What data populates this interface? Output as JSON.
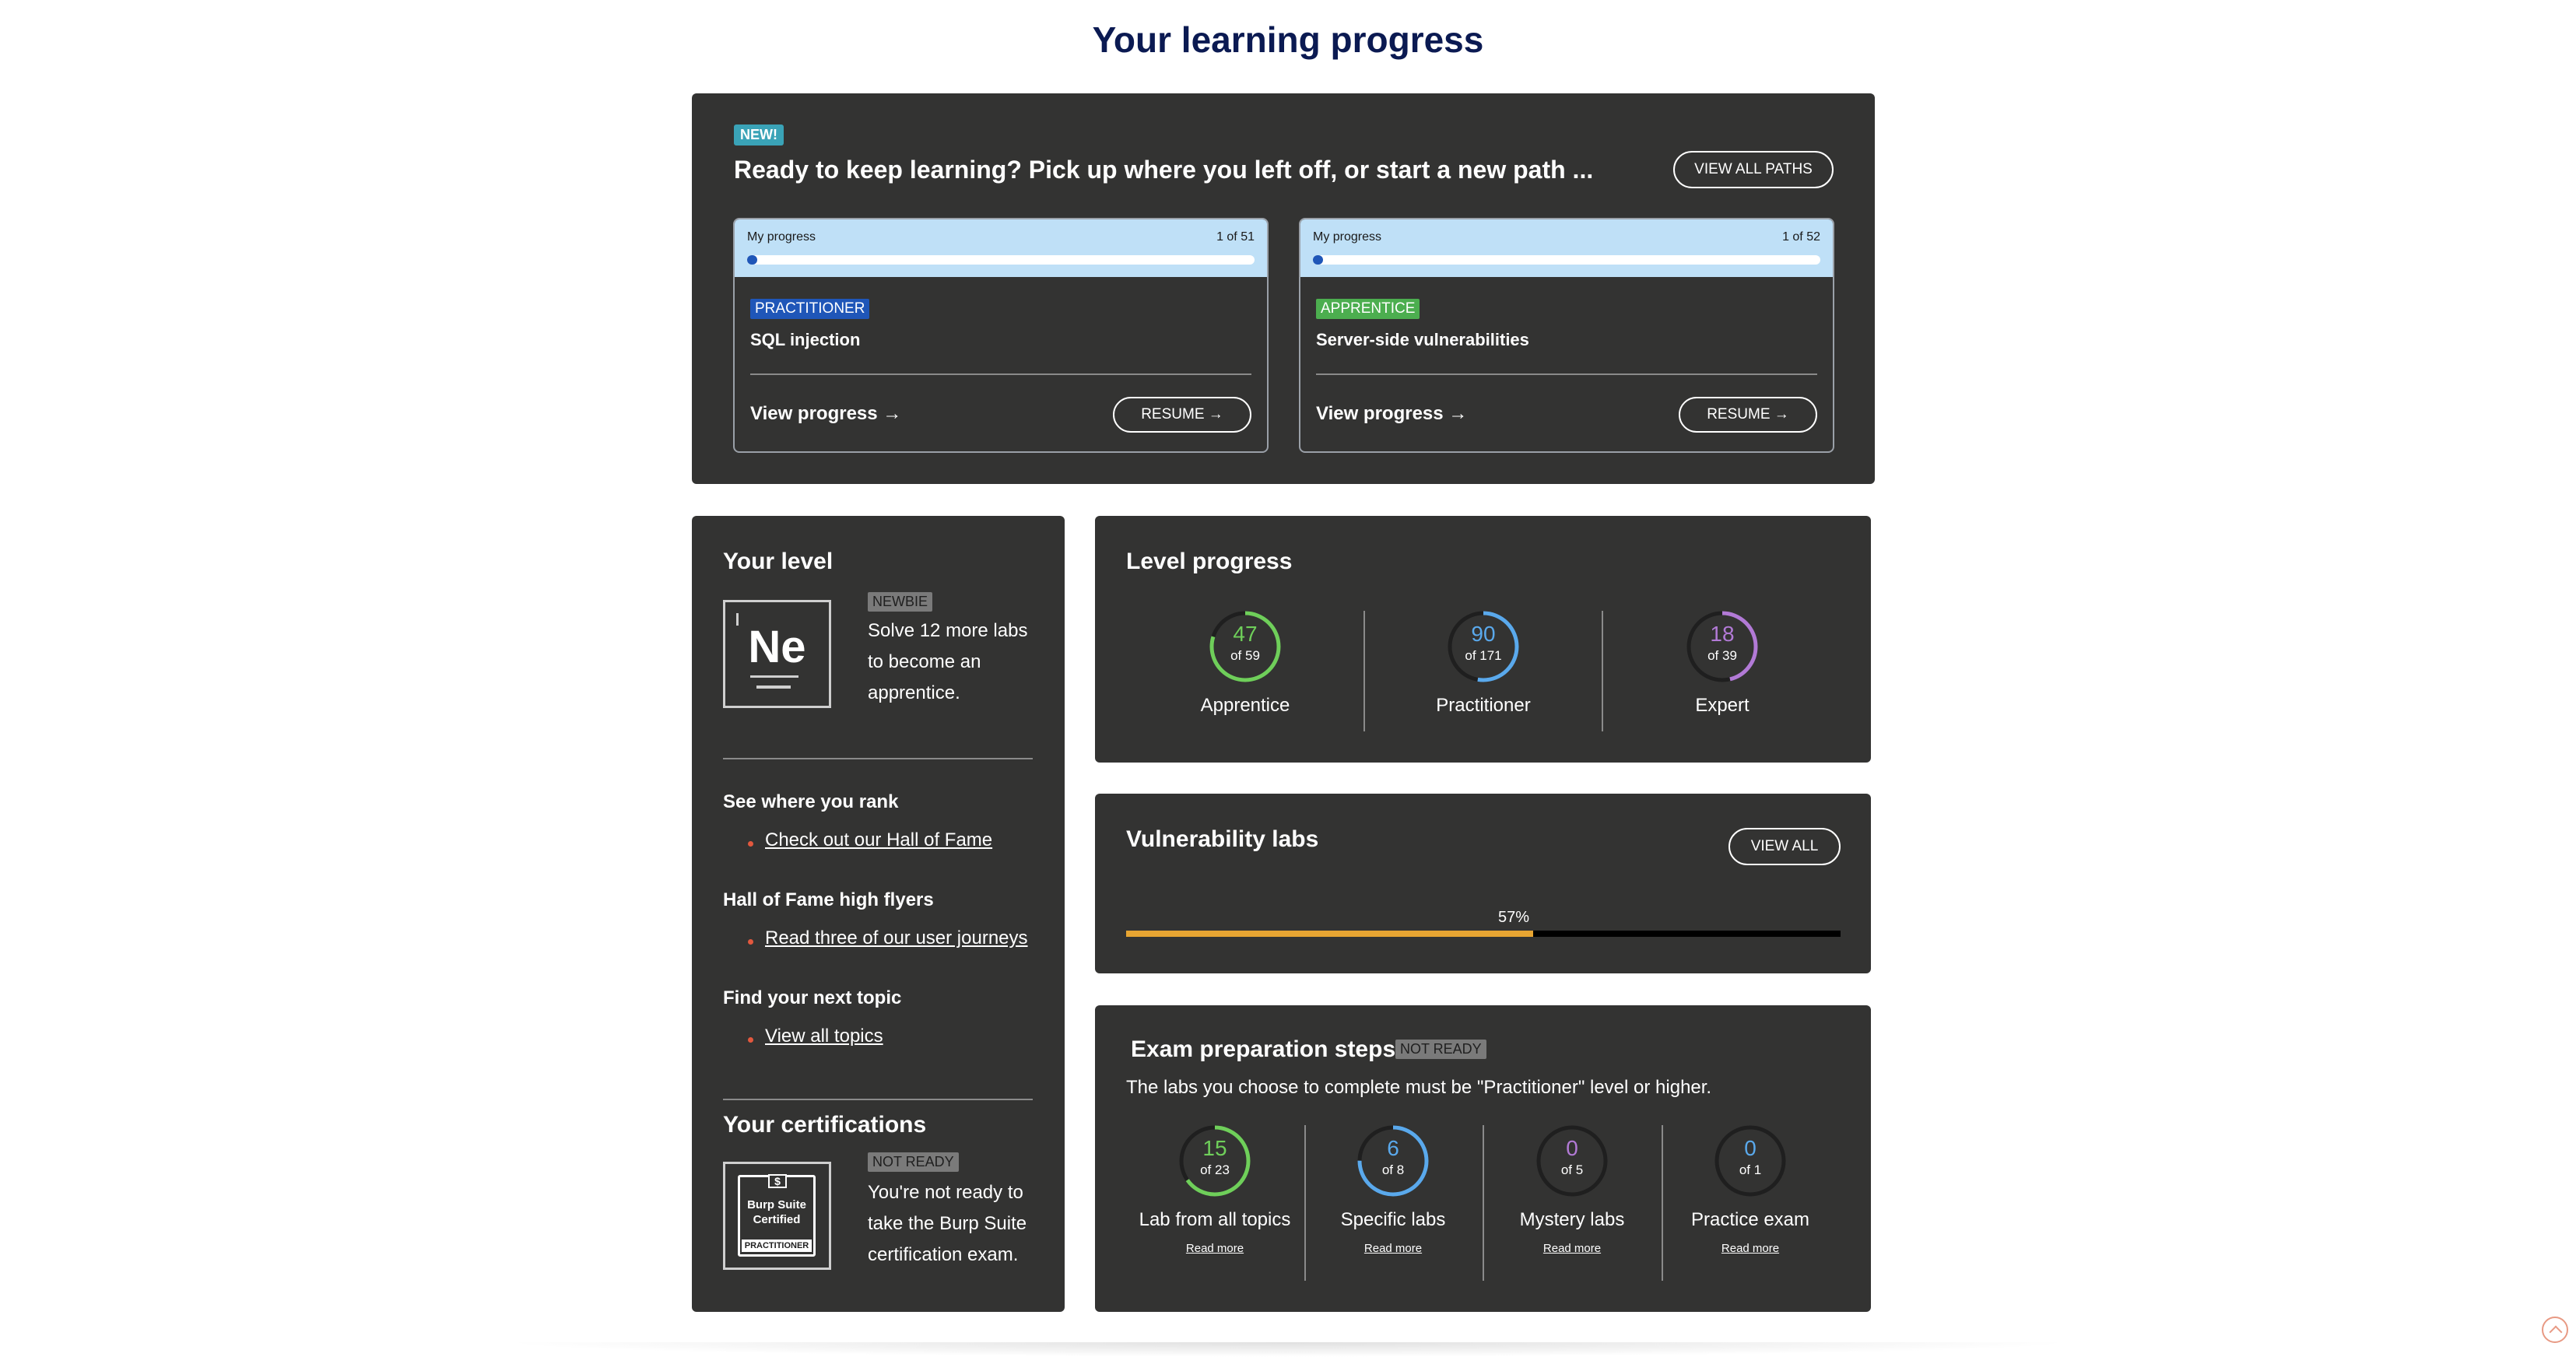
{
  "page": {
    "title": "Your learning progress"
  },
  "paths": {
    "badge": "NEW!",
    "heading": "Ready to keep learning? Pick up where you left off, or start a new path ...",
    "view_all_label": "VIEW ALL PATHS",
    "cards": [
      {
        "progress_label": "My progress",
        "count": "1 of 51",
        "progress": 0.02,
        "level": "PRACTITIONER",
        "level_color": "#1f56b8",
        "title": "SQL injection",
        "view_label": "View progress →",
        "resume_label": "RESUME  →"
      },
      {
        "progress_label": "My progress",
        "count": "1 of 52",
        "progress": 0.02,
        "level": "APPRENTICE",
        "level_color": "#4cae4f",
        "title": "Server-side vulnerabilities",
        "view_label": "View progress →",
        "resume_label": "RESUME  →"
      }
    ]
  },
  "your_level": {
    "title": "Your level",
    "symbol": "Ne",
    "tag": "NEWBIE",
    "desc": "Solve 12 more labs to become an apprentice.",
    "links": [
      {
        "heading": "See where you rank",
        "link": "Check out our Hall of Fame"
      },
      {
        "heading": "Hall of Fame high flyers",
        "link": "Read three of our user journeys"
      },
      {
        "heading": "Find your next topic",
        "link": "View all topics"
      }
    ],
    "cert_title": "Your certifications",
    "cert_tag": "NOT READY",
    "cert_icon_top": "$",
    "cert_icon_text": "Burp Suite Certified",
    "cert_icon_ribbon": "PRACTITIONER",
    "cert_desc": "You're not ready to take the Burp Suite certification exam."
  },
  "level_progress": {
    "title": "Level progress",
    "items": [
      {
        "value": "47",
        "of": "of 59",
        "label": "Apprentice",
        "fraction": 0.797,
        "color": "#6fcf5a"
      },
      {
        "value": "90",
        "of": "of 171",
        "label": "Practitioner",
        "fraction": 0.526,
        "color": "#5aa9ec"
      },
      {
        "value": "18",
        "of": "of 39",
        "label": "Expert",
        "fraction": 0.462,
        "color": "#b27ad6"
      }
    ]
  },
  "vulnerability_labs": {
    "title": "Vulnerability labs",
    "view_all_label": "VIEW ALL",
    "percent_text": "57%",
    "fraction": 0.57,
    "fill_color": "#e7a532"
  },
  "exam": {
    "title": "Exam preparation steps",
    "tag": "NOT READY",
    "desc": "The labs you choose to complete must be \"Practitioner\" level or higher.",
    "steps": [
      {
        "value": "15",
        "of": "of 23",
        "label": "Lab from all topics",
        "read_more": "Read more",
        "fraction": 0.652,
        "color": "#6fcf5a"
      },
      {
        "value": "6",
        "of": "of 8",
        "label": "Specific labs",
        "read_more": "Read more",
        "fraction": 0.75,
        "color": "#5aa9ec"
      },
      {
        "value": "0",
        "of": "of 5",
        "label": "Mystery labs",
        "read_more": "Read more",
        "fraction": 0,
        "color": "#b27ad6"
      },
      {
        "value": "0",
        "of": "of 1",
        "label": "Practice exam",
        "read_more": "Read more",
        "fraction": 0,
        "color": "#5aa9ec"
      }
    ]
  }
}
